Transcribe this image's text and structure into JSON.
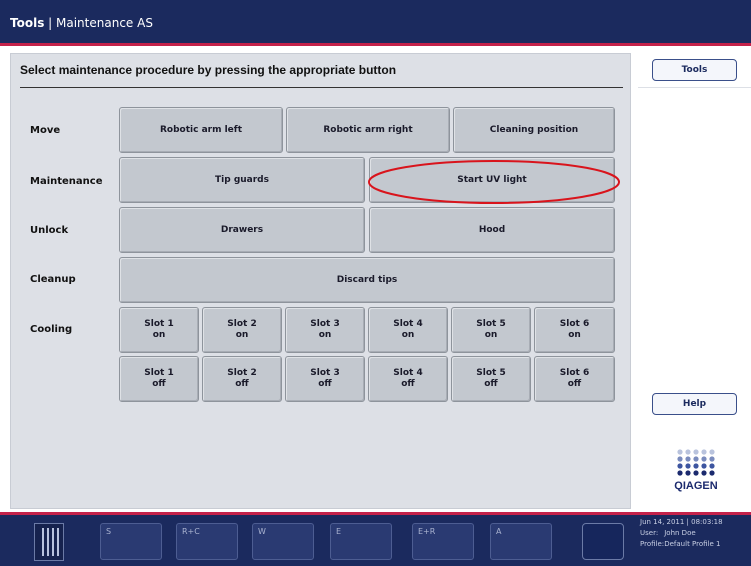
{
  "titlebar": {
    "app": "Tools",
    "separator": " | ",
    "screen": "Maintenance AS"
  },
  "main": {
    "instruction": "Select maintenance procedure by pressing the appropriate button",
    "rows": {
      "move": {
        "label": "Move",
        "buttons": [
          "Robotic arm left",
          "Robotic arm right",
          "Cleaning position"
        ]
      },
      "maintenance": {
        "label": "Maintenance",
        "buttons": [
          "Tip guards",
          "Start UV light"
        ]
      },
      "unlock": {
        "label": "Unlock",
        "buttons": [
          "Drawers",
          "Hood"
        ]
      },
      "cleanup": {
        "label": "Cleanup",
        "buttons": [
          "Discard tips"
        ]
      },
      "cooling": {
        "label": "Cooling",
        "on": [
          {
            "slot": "Slot 1",
            "state": "on"
          },
          {
            "slot": "Slot 2",
            "state": "on"
          },
          {
            "slot": "Slot 3",
            "state": "on"
          },
          {
            "slot": "Slot 4",
            "state": "on"
          },
          {
            "slot": "Slot 5",
            "state": "on"
          },
          {
            "slot": "Slot 6",
            "state": "on"
          }
        ],
        "off": [
          {
            "slot": "Slot 1",
            "state": "off"
          },
          {
            "slot": "Slot 2",
            "state": "off"
          },
          {
            "slot": "Slot 3",
            "state": "off"
          },
          {
            "slot": "Slot 4",
            "state": "off"
          },
          {
            "slot": "Slot 5",
            "state": "off"
          },
          {
            "slot": "Slot 6",
            "state": "off"
          }
        ]
      }
    }
  },
  "side": {
    "tools": "Tools",
    "help": "Help",
    "logo_text": "QIAGEN"
  },
  "bottom": {
    "bays": [
      "S",
      "R+C",
      "W",
      "E",
      "E+R",
      "A"
    ],
    "status": {
      "datetime": "Jun 14, 2011 | 08:03:18",
      "user_label": "User:",
      "user": "John Doe",
      "profile_label": "Profile:",
      "profile": "Default Profile 1"
    }
  },
  "colors": {
    "header": "#1b2a5e",
    "accent": "#c4224a",
    "panel": "#dde0e6",
    "button": "#c3c8cf",
    "highlight": "#d9141c"
  }
}
